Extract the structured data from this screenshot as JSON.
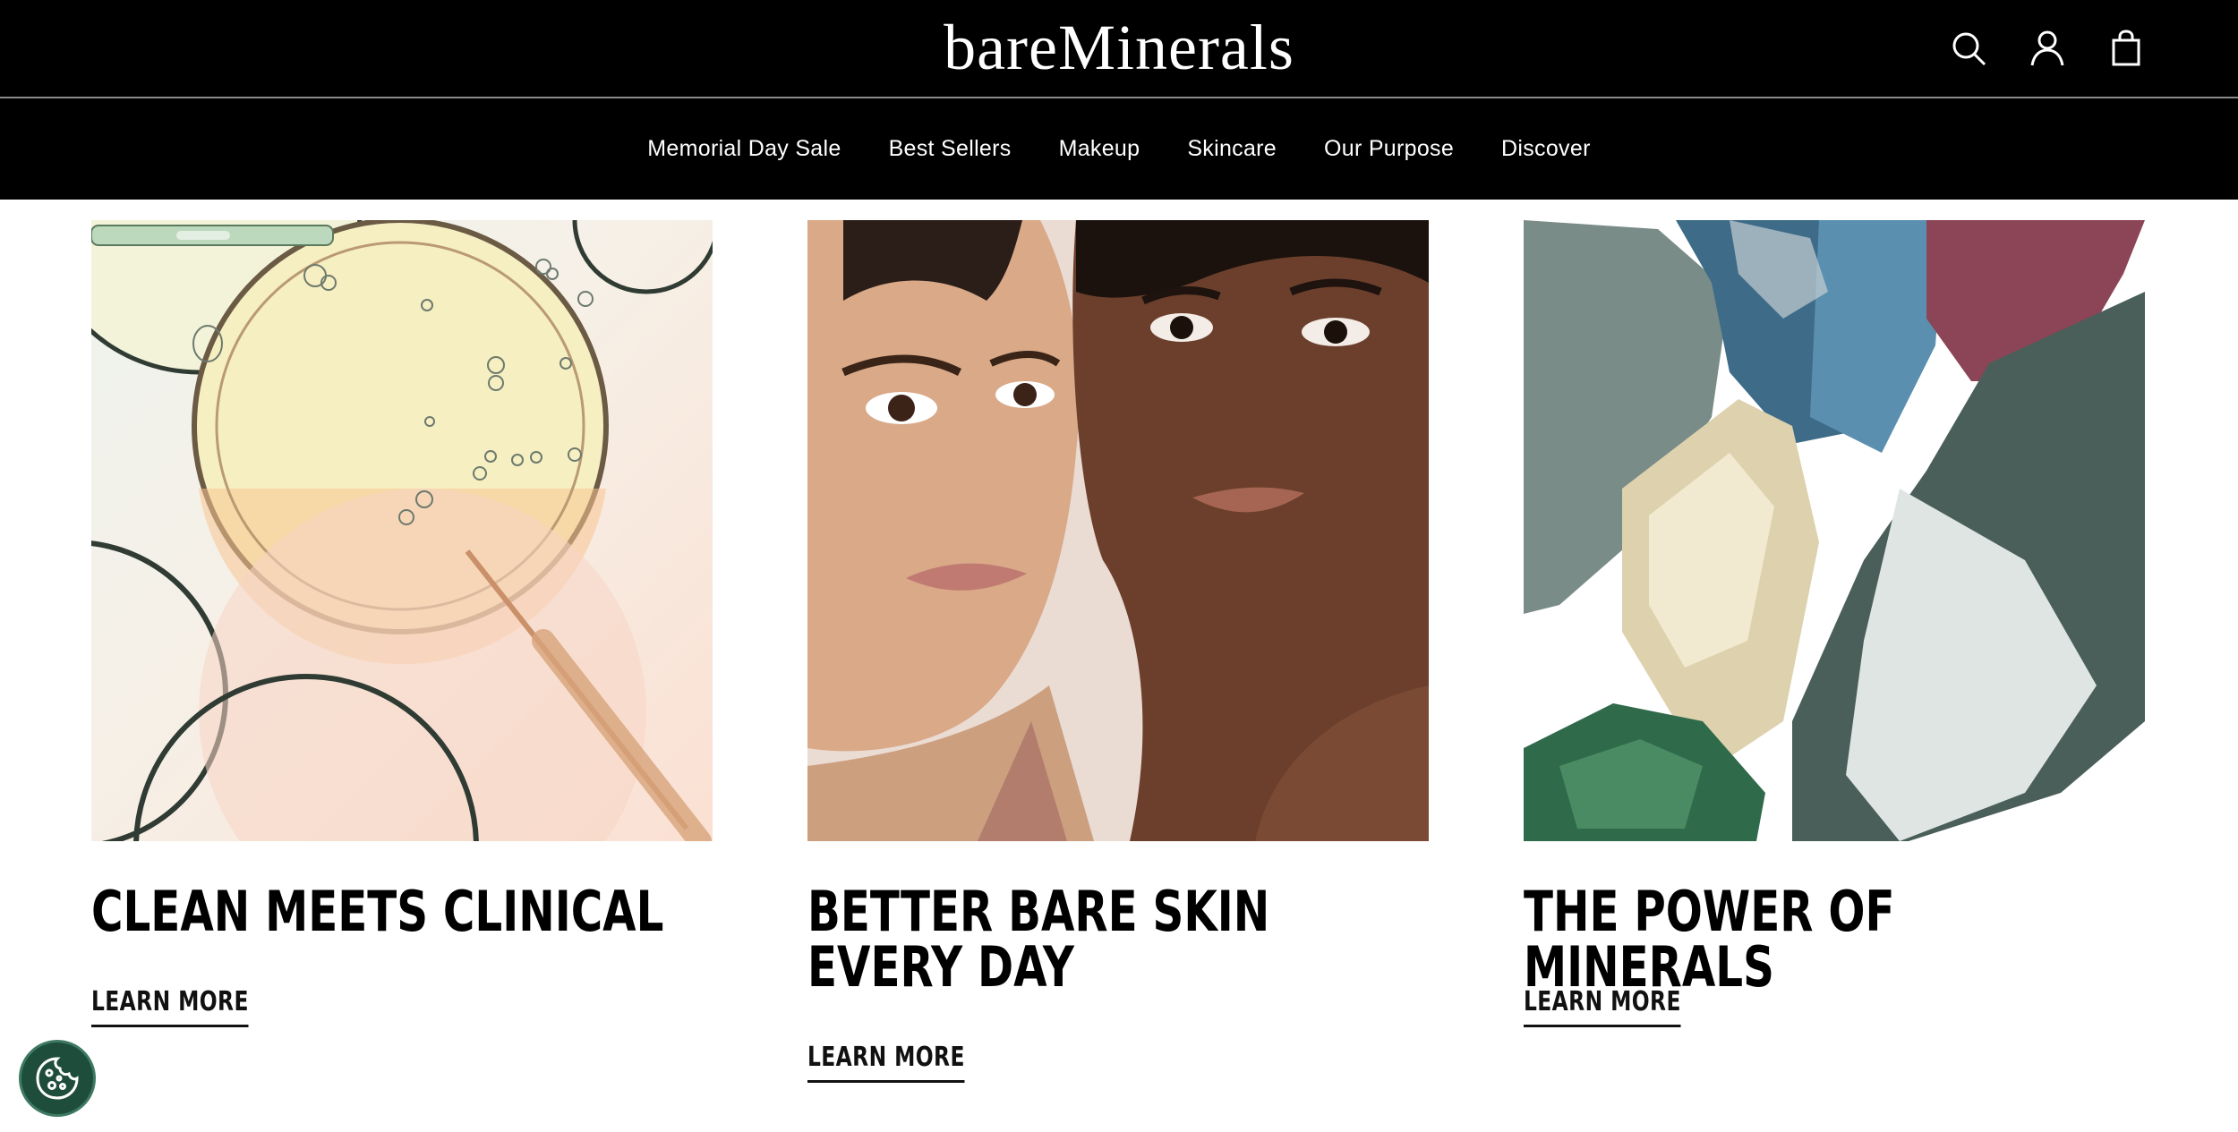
{
  "header": {
    "logo": "bareMinerals",
    "icons": [
      "search-icon",
      "account-icon",
      "shopping-bag-icon"
    ]
  },
  "nav": {
    "items": [
      {
        "label": "Memorial Day Sale"
      },
      {
        "label": "Best Sellers"
      },
      {
        "label": "Makeup"
      },
      {
        "label": "Skincare"
      },
      {
        "label": "Our Purpose"
      },
      {
        "label": "Discover"
      }
    ]
  },
  "cards": [
    {
      "title": "CLEAN MEETS CLINICAL",
      "cta": "LEARN MORE",
      "image": "petri-dishes-serum-image"
    },
    {
      "title": "BETTER BARE SKIN EVERY DAY",
      "cta": "LEARN MORE",
      "image": "two-models-portrait-image"
    },
    {
      "title": "THE POWER OF MINERALS",
      "cta": "LEARN MORE",
      "image": "mineral-crystals-image"
    }
  ],
  "cookie_button": {
    "icon": "cookie-icon"
  },
  "colors": {
    "header_bg": "#000000",
    "cookie_bg": "#1f4d3c"
  }
}
